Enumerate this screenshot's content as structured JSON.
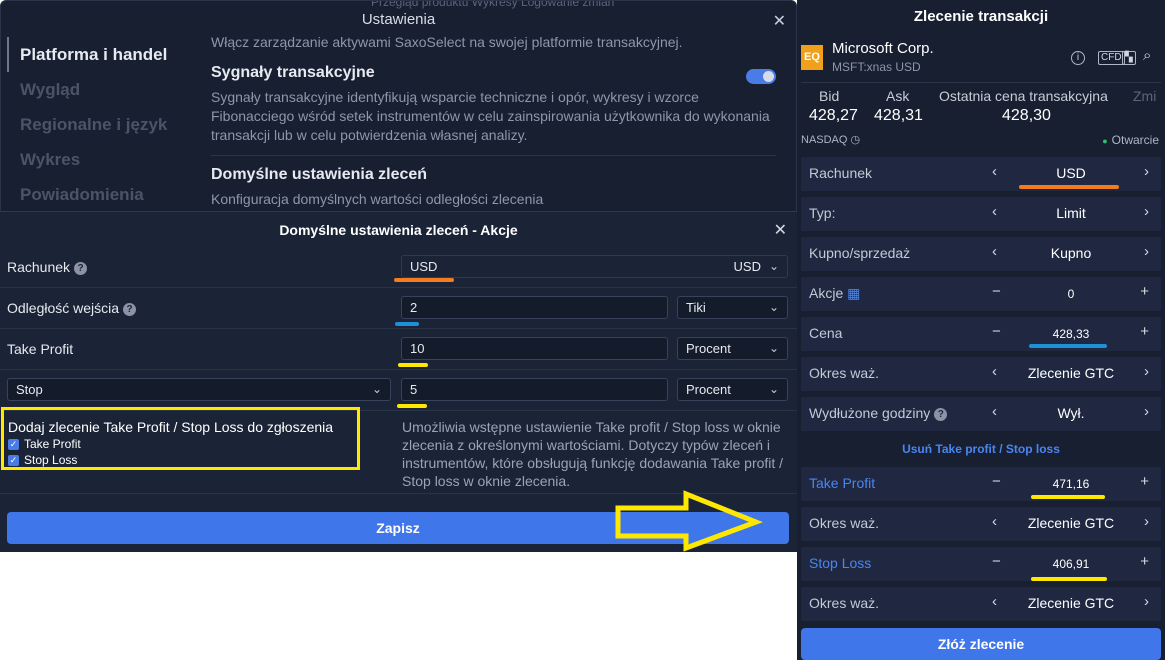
{
  "settings": {
    "title": "Ustawienia",
    "bg_tabs": "Przegląd produktu   Wykresy   Logowanie zmian",
    "nav": [
      "Platforma i handel",
      "Wygląd",
      "Regionalne i język",
      "Wykres",
      "Powiadomienia"
    ],
    "intro": "Włącz zarządzanie aktywami SaxoSelect na swojej platformie transakcyjnej.",
    "signals_title": "Sygnały transakcyjne",
    "signals_desc": "Sygnały transakcyjne identyfikują wsparcie techniczne i opór, wykresy i wzorce Fibonacciego wśród setek instrumentów w celu zainspirowania użytkownika do wykonania transakcji lub w celu potwierdzenia własnej analizy.",
    "defaults_title": "Domyślne ustawienia zleceń",
    "defaults_desc": "Konfiguracja domyślnych wartości odległości zlecenia"
  },
  "modal": {
    "title": "Domyślne ustawienia zleceń - Akcje",
    "account_label": "Rachunek",
    "account_value": "USD",
    "account_select": "USD",
    "entry_label": "Odległość wejścia",
    "entry_value": "2",
    "entry_unit": "Tiki",
    "tp_label": "Take Profit",
    "tp_value": "10",
    "tp_unit": "Procent",
    "stop_select": "Stop",
    "stop_value": "5",
    "stop_unit": "Procent",
    "add_title": "Dodaj zlecenie Take Profit / Stop Loss do zgłoszenia",
    "cb_tp": "Take Profit",
    "cb_sl": "Stop Loss",
    "help": "Umożliwia wstępne ustawienie Take profit / Stop loss w oknie zlecenia z określonymi wartościami. Dotyczy typów zleceń i instrumentów, które obsługują funkcję dodawania Take profit / Stop loss w oknie zlecenia.",
    "save": "Zapisz"
  },
  "ticket": {
    "title": "Zlecenie transakcji",
    "badge": "EQ",
    "name": "Microsoft Corp.",
    "symbol": "MSFT:xnas USD",
    "bid_label": "Bid",
    "bid": "428,27",
    "ask_label": "Ask",
    "ask": "428,31",
    "last_label": "Ostatnia cena transakcyjna",
    "last": "428,30",
    "change_label": "Zmi",
    "exchange": "NASDAQ",
    "status": "Otwarcie",
    "rows": {
      "account": {
        "label": "Rachunek",
        "value": "USD"
      },
      "type": {
        "label": "Typ:",
        "value": "Limit"
      },
      "side": {
        "label": "Kupno/sprzedaż",
        "value": "Kupno"
      },
      "shares": {
        "label": "Akcje",
        "value": "0"
      },
      "price": {
        "label": "Cena",
        "value": "428,33"
      },
      "validity": {
        "label": "Okres waż.",
        "value": "Zlecenie GTC"
      },
      "extended": {
        "label": "Wydłużone godziny",
        "value": "Wył."
      },
      "tp": {
        "label": "Take Profit",
        "value": "471,16"
      },
      "tp_validity": {
        "label": "Okres waż.",
        "value": "Zlecenie GTC"
      },
      "sl": {
        "label": "Stop Loss",
        "value": "406,91"
      },
      "sl_validity": {
        "label": "Okres waż.",
        "value": "Zlecenie GTC"
      }
    },
    "remove_tp_sl": "Usuń Take profit / Stop loss",
    "place": "Złóż zlecenie"
  },
  "colors": {
    "orange": "#f47b20",
    "blue": "#1e90d6",
    "yellow": "#ffe800",
    "accent": "#3f76ea"
  }
}
